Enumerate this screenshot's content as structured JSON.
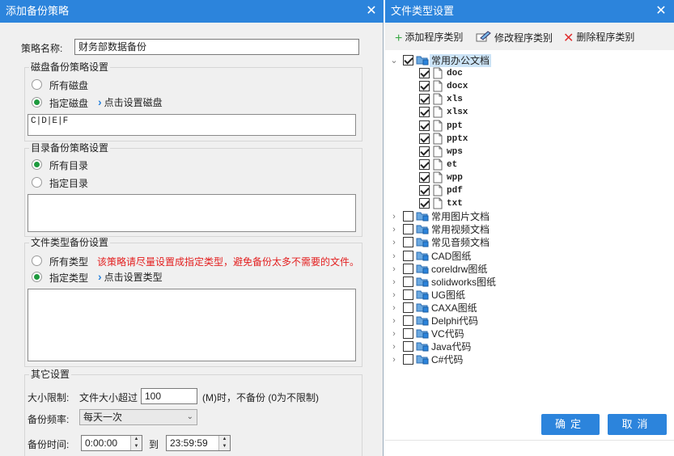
{
  "left_dialog": {
    "title": "添加备份策略",
    "strategy_name_label": "策略名称:",
    "strategy_name_value": "财务部数据备份",
    "disk_group": {
      "title": "磁盘备份策略设置",
      "all_label": "所有磁盘",
      "specified_label": "指定磁盘",
      "set_link": "点击设置磁盘",
      "value": "C|D|E|F"
    },
    "dir_group": {
      "title": "目录备份策略设置",
      "all_label": "所有目录",
      "specified_label": "指定目录"
    },
    "type_group": {
      "title": "文件类型备份设置",
      "all_label": "所有类型",
      "warning": "该策略请尽量设置成指定类型，避免备份太多不需要的文件。",
      "specified_label": "指定类型",
      "set_link": "点击设置类型"
    },
    "other_group": {
      "title": "其它设置",
      "size_label": "大小限制:",
      "size_prefix": "文件大小超过",
      "size_value": "100",
      "size_suffix": "(M)时，不备份 (0为不限制)",
      "freq_label": "备份频率:",
      "freq_value": "每天一次",
      "time_label": "备份时间:",
      "time_start": "0:00:00",
      "time_to": "到",
      "time_end": "23:59:59"
    }
  },
  "right_dialog": {
    "title": "文件类型设置",
    "toolbar": {
      "add_label": "添加程序类别",
      "edit_label": "修改程序类别",
      "delete_label": "删除程序类别"
    },
    "root": {
      "label": "常用办公文档",
      "checked": true
    },
    "children": [
      "doc",
      "docx",
      "xls",
      "xlsx",
      "ppt",
      "pptx",
      "wps",
      "et",
      "wpp",
      "pdf",
      "txt"
    ],
    "categories": [
      "常用图片文档",
      "常用视频文档",
      "常见音频文档",
      "CAD图纸",
      "coreldrw图纸",
      "solidworks图纸",
      "UG图纸",
      "CAXA图纸",
      "Delphi代码",
      "VC代码",
      "Java代码",
      "C#代码"
    ],
    "ok_label": "确定",
    "cancel_label": "取消"
  },
  "icons": {
    "close": "close-icon",
    "plus": "plus-icon",
    "edit": "edit-icon",
    "delete": "delete-icon",
    "chevron": "chevron-right-icon",
    "file": "file-icon",
    "category": "category-icon"
  },
  "colors": {
    "title_bar": "#2c84dc",
    "warning": "#e32020",
    "radio_on": "#1e9a3e",
    "add_icon": "#3aa845",
    "delete_icon": "#e03030",
    "selected_bg": "#cce4f7"
  }
}
